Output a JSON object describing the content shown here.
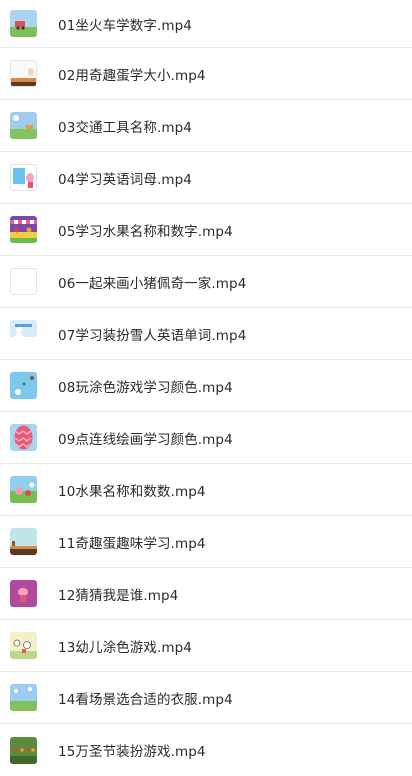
{
  "files": [
    {
      "name": "01坐火车学数字.mp4",
      "icon": "video-thumbnail-train-icon"
    },
    {
      "name": "02用奇趣蛋学大小.mp4",
      "icon": "video-thumbnail-egg-icon"
    },
    {
      "name": "03交通工具名称.mp4",
      "icon": "video-thumbnail-vehicles-icon"
    },
    {
      "name": "04学习英语词母.mp4",
      "icon": "video-thumbnail-letters-icon"
    },
    {
      "name": "05学习水果名称和数字.mp4",
      "icon": "video-thumbnail-fruit-stall-icon"
    },
    {
      "name": "06一起来画小猪佩奇一家.mp4",
      "icon": "video-thumbnail-drawing-icon"
    },
    {
      "name": "07学习装扮雪人英语单词.mp4",
      "icon": "video-thumbnail-snowman-icon"
    },
    {
      "name": "08玩涂色游戏学习颜色.mp4",
      "icon": "video-thumbnail-coloring-icon"
    },
    {
      "name": "09点连线绘画学习颜色.mp4",
      "icon": "video-thumbnail-dots-icon"
    },
    {
      "name": "10水果名称和数数.mp4",
      "icon": "video-thumbnail-fruit-icon"
    },
    {
      "name": "11奇趣蛋趣味学习.mp4",
      "icon": "video-thumbnail-egg-fun-icon"
    },
    {
      "name": "12猜猜我是谁.mp4",
      "icon": "video-thumbnail-guess-icon"
    },
    {
      "name": "13幼儿涂色游戏.mp4",
      "icon": "video-thumbnail-paint-icon"
    },
    {
      "name": "14看场景选合适的衣服.mp4",
      "icon": "video-thumbnail-clothes-icon"
    },
    {
      "name": "15万圣节装扮游戏.mp4",
      "icon": "video-thumbnail-halloween-icon"
    }
  ]
}
